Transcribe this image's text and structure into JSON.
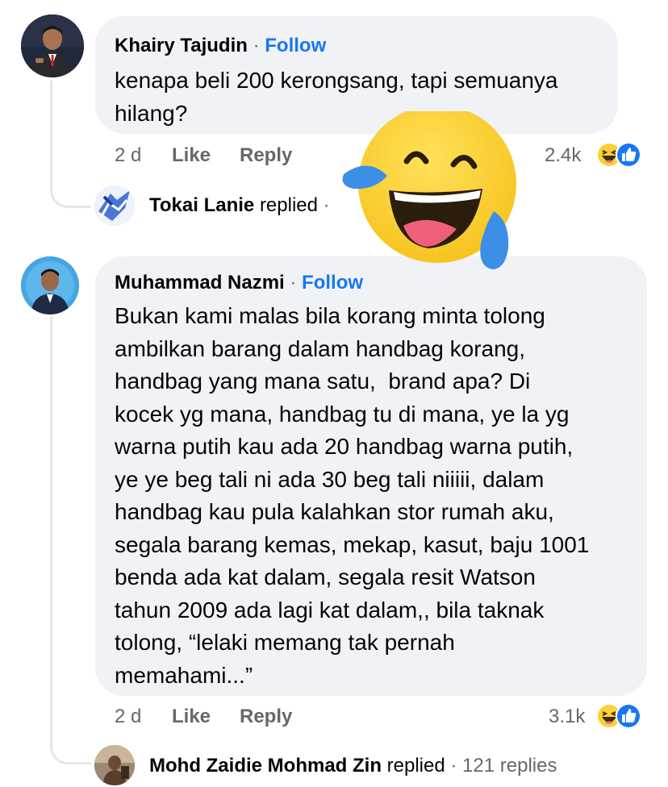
{
  "comments": [
    {
      "author": "Khairy Tajudin",
      "separator": "·",
      "follow_label": "Follow",
      "lines": [
        "kenapa beli 200 kerongsang, tapi semuanya",
        "hilang?"
      ],
      "time": "2 d",
      "like_label": "Like",
      "reply_label": "Reply",
      "reaction_count": "2.4k",
      "reaction_icons": [
        "haha-icon",
        "like-icon"
      ],
      "reply_preview": {
        "name": "Tokai Lanie",
        "action": "replied",
        "separator": "·"
      }
    },
    {
      "author": "Muhammad Nazmi",
      "separator": "·",
      "follow_label": "Follow",
      "lines": [
        "Bukan kami malas bila korang minta tolong",
        "ambilkan barang dalam handbag korang,",
        "handbag yang mana satu,  brand apa? Di",
        "kocek yg mana, handbag tu di mana, ye la yg",
        "warna putih kau ada 20 handbag warna putih,",
        "ye ye beg tali ni ada 30 beg tali niiiii, dalam",
        "handbag kau pula kalahkan stor rumah aku,",
        "segala barang kemas, mekap, kasut, baju 1001",
        "benda ada kat dalam, segala resit Watson",
        "tahun 2009 ada lagi kat dalam,, bila taknak",
        "tolong, “lelaki memang tak pernah",
        "memahami...”"
      ],
      "time": "2 d",
      "like_label": "Like",
      "reply_label": "Reply",
      "reaction_count": "3.1k",
      "reaction_icons": [
        "haha-icon",
        "like-icon"
      ],
      "reply_preview": {
        "name": "Mohd Zaidie Mohmad Zin",
        "action": "replied",
        "separator": "·",
        "replies_count": "121 replies"
      }
    }
  ],
  "overlay_emoji": "laughing-tears-emoji",
  "colors": {
    "bubble": "#f0f2f5",
    "link_blue": "#1877f2",
    "muted": "#65676b",
    "emoji_yellow": "#fbd133",
    "tear_blue": "#3d8fe6"
  }
}
